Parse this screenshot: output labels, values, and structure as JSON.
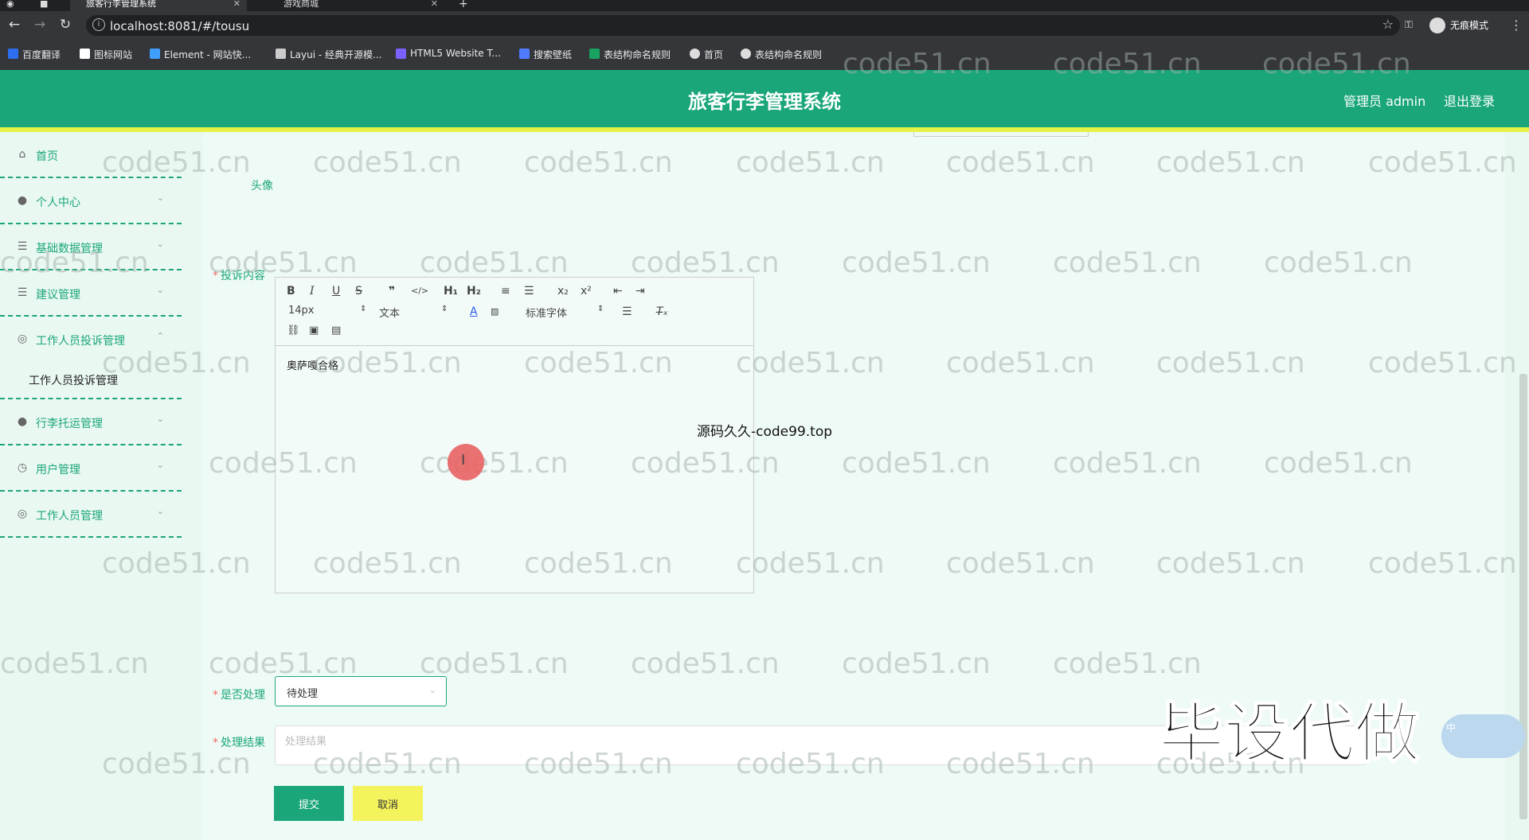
{
  "browser": {
    "tabs": [
      {
        "title": "旅客行李管理系统",
        "active": true
      },
      {
        "title": "游戏商城",
        "active": false
      }
    ],
    "new_tab": "+",
    "url": "localhost:8081/#/tousu",
    "incognito_label": "无痕模式",
    "bookmarks": [
      {
        "label": "百度翻译",
        "color": "#2d6ff0"
      },
      {
        "label": "图标网站",
        "color": "#ffffff"
      },
      {
        "label": "Element - 网站快...",
        "color": "#409eff"
      },
      {
        "label": "Layui - 经典开源模...",
        "color": "#cccccc"
      },
      {
        "label": "HTML5 Website T...",
        "color": "#7b61ff"
      },
      {
        "label": "搜索壁纸",
        "color": "#4f7cff"
      },
      {
        "label": "表结构命名规则",
        "color": "#1aa260"
      },
      {
        "label": "首页",
        "color": "#dddddd"
      },
      {
        "label": "表结构命名规则",
        "color": "#dddddd"
      }
    ]
  },
  "header": {
    "title": "旅客行李管理系统",
    "admin_label": "管理员 admin",
    "logout_label": "退出登录"
  },
  "sidebar": {
    "items": [
      {
        "label": "首页",
        "icon": "home-icon",
        "expandable": false
      },
      {
        "label": "个人中心",
        "icon": "user-icon",
        "expandable": true
      },
      {
        "label": "基础数据管理",
        "icon": "list-icon",
        "expandable": true
      },
      {
        "label": "建议管理",
        "icon": "list-icon",
        "expandable": true
      },
      {
        "label": "工作人员投诉管理",
        "icon": "globe-icon",
        "expandable": true,
        "open": true
      },
      {
        "label": "行李托运管理",
        "icon": "location-icon",
        "expandable": true
      },
      {
        "label": "用户管理",
        "icon": "clock-icon",
        "expandable": true
      },
      {
        "label": "工作人员管理",
        "icon": "globe-icon",
        "expandable": true
      }
    ],
    "sub_item": "工作人员投诉管理"
  },
  "form": {
    "avatar_label": "头像",
    "content_label": "投诉内容",
    "content_value": "奥萨嘎合格",
    "editor_toolbar": {
      "font_size": "14px",
      "block_type": "文本",
      "font_family": "标准字体"
    },
    "handled_label": "是否处理",
    "handled_value": "待处理",
    "result_label": "处理结果",
    "result_placeholder": "处理结果",
    "submit_label": "提交",
    "cancel_label": "取消"
  },
  "overlay": {
    "center_text": "源码久久-code99.top",
    "watermark": "code51.cn",
    "promo_text": "毕设代做",
    "badge_text": "中"
  },
  "colors": {
    "primary": "#1aa67a",
    "accent_yellow": "#f4f25d",
    "required": "#f56c6c"
  }
}
